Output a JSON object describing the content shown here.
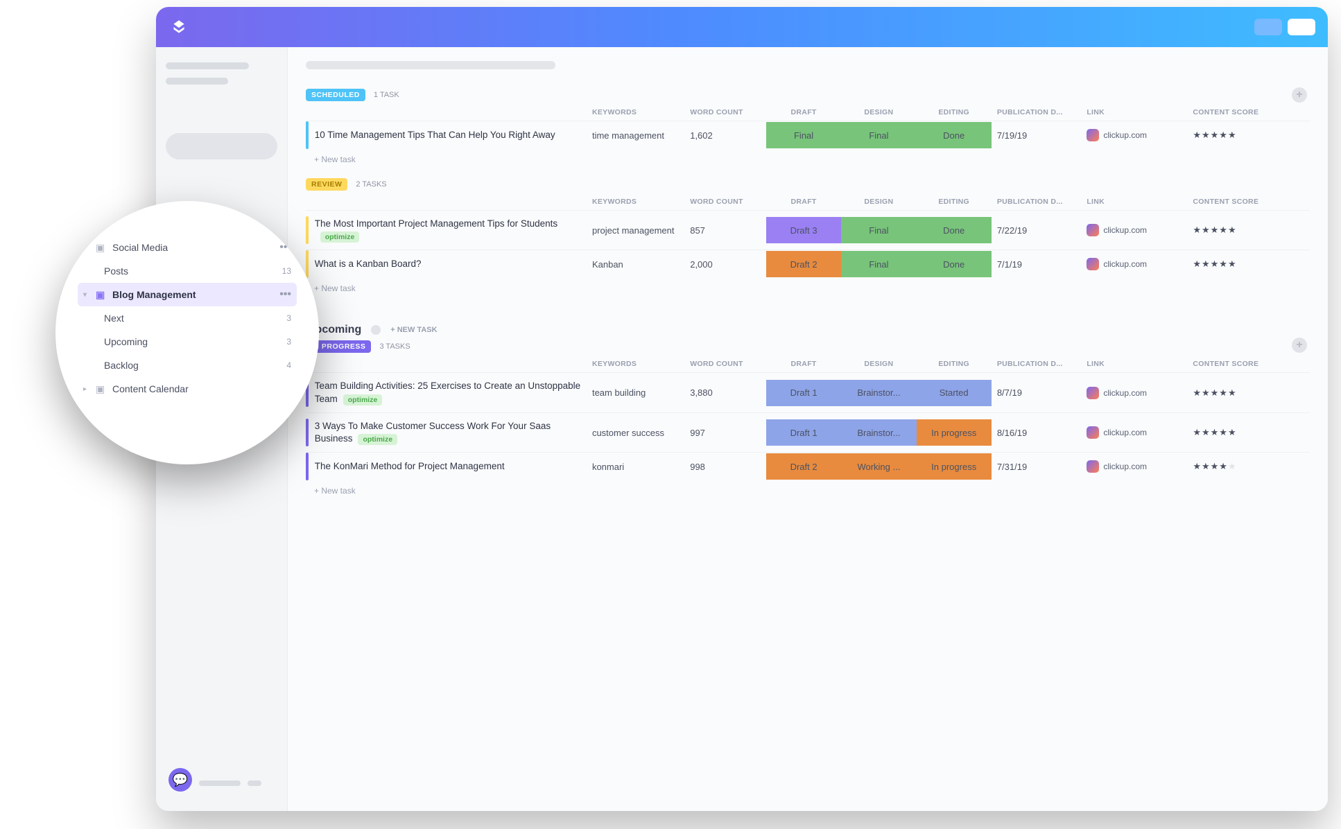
{
  "titlebar": {},
  "columns": {
    "keywords": "KEYWORDS",
    "wordcount": "WORD COUNT",
    "draft": "DRAFT",
    "design": "DESIGN",
    "editing": "EDITING",
    "pubdate": "PUBLICATION D...",
    "link": "LINK",
    "score": "CONTENT SCORE"
  },
  "groups": [
    {
      "key": "scheduled",
      "label": "SCHEDULED",
      "task_count": "1 TASK",
      "rows": [
        {
          "title": "10 Time Management Tips That Can Help You Right Away",
          "chip": "",
          "keywords": "time management",
          "wordcount": "1,602",
          "draft": {
            "t": "Final",
            "c": "sg-green"
          },
          "design": {
            "t": "Final",
            "c": "sg-green"
          },
          "editing": {
            "t": "Done",
            "c": "sg-green"
          },
          "pubdate": "7/19/19",
          "link": "clickup.com",
          "stars": 5
        }
      ]
    },
    {
      "key": "review",
      "label": "REVIEW",
      "task_count": "2 TASKS",
      "rows": [
        {
          "title": "The Most Important Project Management Tips for Students",
          "chip": "optimize",
          "keywords": "project management",
          "wordcount": "857",
          "draft": {
            "t": "Draft 3",
            "c": "sg-purple"
          },
          "design": {
            "t": "Final",
            "c": "sg-green"
          },
          "editing": {
            "t": "Done",
            "c": "sg-green"
          },
          "pubdate": "7/22/19",
          "link": "clickup.com",
          "stars": 5
        },
        {
          "title": "What is a Kanban Board?",
          "chip": "",
          "keywords": "Kanban",
          "wordcount": "2,000",
          "draft": {
            "t": "Draft 2",
            "c": "sg-orange"
          },
          "design": {
            "t": "Final",
            "c": "sg-green"
          },
          "editing": {
            "t": "Done",
            "c": "sg-green"
          },
          "pubdate": "7/1/19",
          "link": "clickup.com",
          "stars": 5
        }
      ]
    }
  ],
  "upcoming": {
    "title": "Upcoming",
    "new_task": "+ NEW TASK",
    "group": {
      "key": "inprog",
      "label": "IN PROGRESS",
      "task_count": "3 TASKS",
      "rows": [
        {
          "title": "Team Building Activities: 25 Exercises to Create an Unstoppable Team",
          "chip": "optimize",
          "keywords": "team building",
          "wordcount": "3,880",
          "draft": {
            "t": "Draft 1",
            "c": "sg-blue"
          },
          "design": {
            "t": "Brainstor...",
            "c": "sg-blue"
          },
          "editing": {
            "t": "Started",
            "c": "sg-blue"
          },
          "pubdate": "8/7/19",
          "link": "clickup.com",
          "stars": 5
        },
        {
          "title": "3 Ways To Make Customer Success Work For Your Saas Business",
          "chip": "optimize",
          "keywords": "customer success",
          "wordcount": "997",
          "draft": {
            "t": "Draft 1",
            "c": "sg-blue"
          },
          "design": {
            "t": "Brainstor...",
            "c": "sg-blue"
          },
          "editing": {
            "t": "In progress",
            "c": "sg-orange"
          },
          "pubdate": "8/16/19",
          "link": "clickup.com",
          "stars": 5
        },
        {
          "title": "The KonMari Method for Project Management",
          "chip": "",
          "keywords": "konmari",
          "wordcount": "998",
          "draft": {
            "t": "Draft 2",
            "c": "sg-orange"
          },
          "design": {
            "t": "Working ...",
            "c": "sg-orange"
          },
          "editing": {
            "t": "In progress",
            "c": "sg-orange"
          },
          "pubdate": "7/31/19",
          "link": "clickup.com",
          "stars": 4
        }
      ]
    }
  },
  "new_task_label": "+ New task",
  "tree": {
    "items": [
      {
        "kind": "folder",
        "name": "Social Media",
        "caret": "down",
        "count": "",
        "dots": true,
        "active": false
      },
      {
        "kind": "child",
        "name": "Posts",
        "count": "13"
      },
      {
        "kind": "folder",
        "name": "Blog Management",
        "caret": "down",
        "count": "",
        "dots": true,
        "active": true,
        "purple": true
      },
      {
        "kind": "child",
        "name": "Next",
        "count": "3"
      },
      {
        "kind": "child",
        "name": "Upcoming",
        "count": "3"
      },
      {
        "kind": "child",
        "name": "Backlog",
        "count": "4"
      },
      {
        "kind": "folder",
        "name": "Content Calendar",
        "caret": "right",
        "count": "",
        "dots": false
      }
    ]
  }
}
